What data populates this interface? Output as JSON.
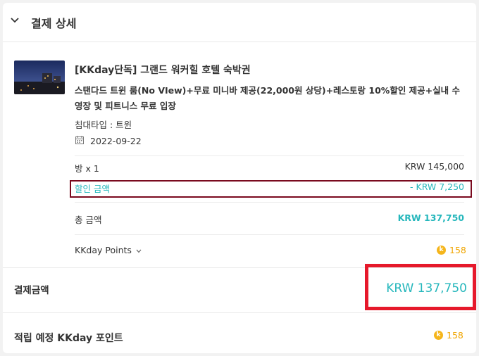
{
  "header": {
    "title": "결제 상세"
  },
  "product": {
    "title": "[KKday단독] 그랜드 워커힐 호텔 숙박권",
    "description": "스탠다드 트윈 룸(No VIew)+무료 미니바 제공(22,000원 상당)+레스토랑 10%할인 제공+실내 수영장 및 피트니스 무료 입장",
    "bed_type": "침대타입 : 트윈",
    "date": "2022-09-22"
  },
  "rows": {
    "room_label": "방 x 1",
    "room_value": "KRW 145,000",
    "discount_label": "할인 금액",
    "discount_value": "- KRW 7,250",
    "total_label": "총 금액",
    "total_value": "KRW 137,750",
    "points_label": "KKday Points",
    "points_value": "158"
  },
  "payment": {
    "label": "결제금액",
    "value": "KRW 137,750"
  },
  "earn": {
    "label": "적립 예정 KKday 포인트",
    "value": "158"
  },
  "icons": {
    "coin": "k"
  },
  "colors": {
    "accent": "#26b7bc",
    "points": "#f0a500",
    "highlight_red": "#e6192b",
    "highlight_maroon": "#7a0a1e"
  }
}
